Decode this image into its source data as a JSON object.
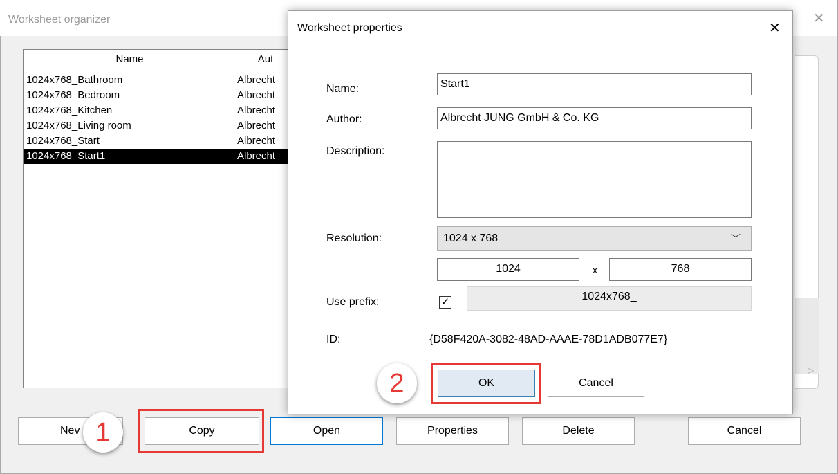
{
  "outer": {
    "title": "Worksheet organizer",
    "columns": [
      "Name",
      "Aut"
    ],
    "rows": [
      {
        "name": "1024x768_Bathroom",
        "author": "Albrecht"
      },
      {
        "name": "1024x768_Bedroom",
        "author": "Albrecht"
      },
      {
        "name": "1024x768_Kitchen",
        "author": "Albrecht"
      },
      {
        "name": "1024x768_Living room",
        "author": "Albrecht"
      },
      {
        "name": "1024x768_Start",
        "author": "Albrecht"
      },
      {
        "name": "1024x768_Start1",
        "author": "Albrecht",
        "selected": true
      }
    ],
    "buttons": {
      "new": "Nev",
      "copy": "Copy",
      "open": "Open",
      "properties": "Properties",
      "delete": "Delete",
      "cancel": "Cancel"
    },
    "callout_1": "1"
  },
  "dialog": {
    "title": "Worksheet properties",
    "labels": {
      "name": "Name:",
      "author": "Author:",
      "description": "Description:",
      "resolution": "Resolution:",
      "use_prefix": "Use prefix:",
      "id": "ID:",
      "x": "x"
    },
    "values": {
      "name": "Start1",
      "author": "Albrecht JUNG GmbH & Co. KG",
      "description": "",
      "resolution": "1024 x 768",
      "width": "1024",
      "height": "768",
      "use_prefix_checked": true,
      "prefix": "1024x768_",
      "id": "{D58F420A-3082-48AD-AAAE-78D1ADB077E7}"
    },
    "buttons": {
      "ok": "OK",
      "cancel": "Cancel"
    },
    "callout_2": "2"
  },
  "colors": {
    "highlight_red": "#e53935",
    "selection": "#000000",
    "focus_blue": "#0078d7"
  }
}
